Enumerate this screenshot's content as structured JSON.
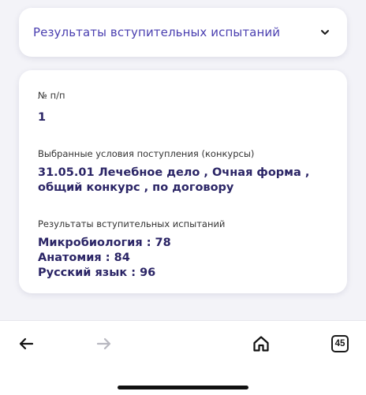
{
  "accordion": {
    "title": "Результаты вступительных испытаний",
    "chevron_icon": "chevron-down-icon"
  },
  "details": {
    "number_label": "№ п/п",
    "number_value": "1",
    "conditions_label": "Выбранные условия поступления (конкурсы)",
    "conditions_value": "31.05.01 Лечебное дело , Очная форма , общий конкурс , по договору",
    "results_label": "Результаты вступительных испытаний",
    "results": [
      "Микробиология : 78",
      "Анатомия : 84",
      "Русский язык : 96"
    ]
  },
  "toolbar": {
    "back_icon": "arrow-left-icon",
    "forward_icon": "arrow-right-icon",
    "home_icon": "home-icon",
    "tabs_count": "45"
  },
  "colors": {
    "accent": "#4a3fb0",
    "value_text": "#2b2566",
    "background": "#f3f3f8"
  }
}
